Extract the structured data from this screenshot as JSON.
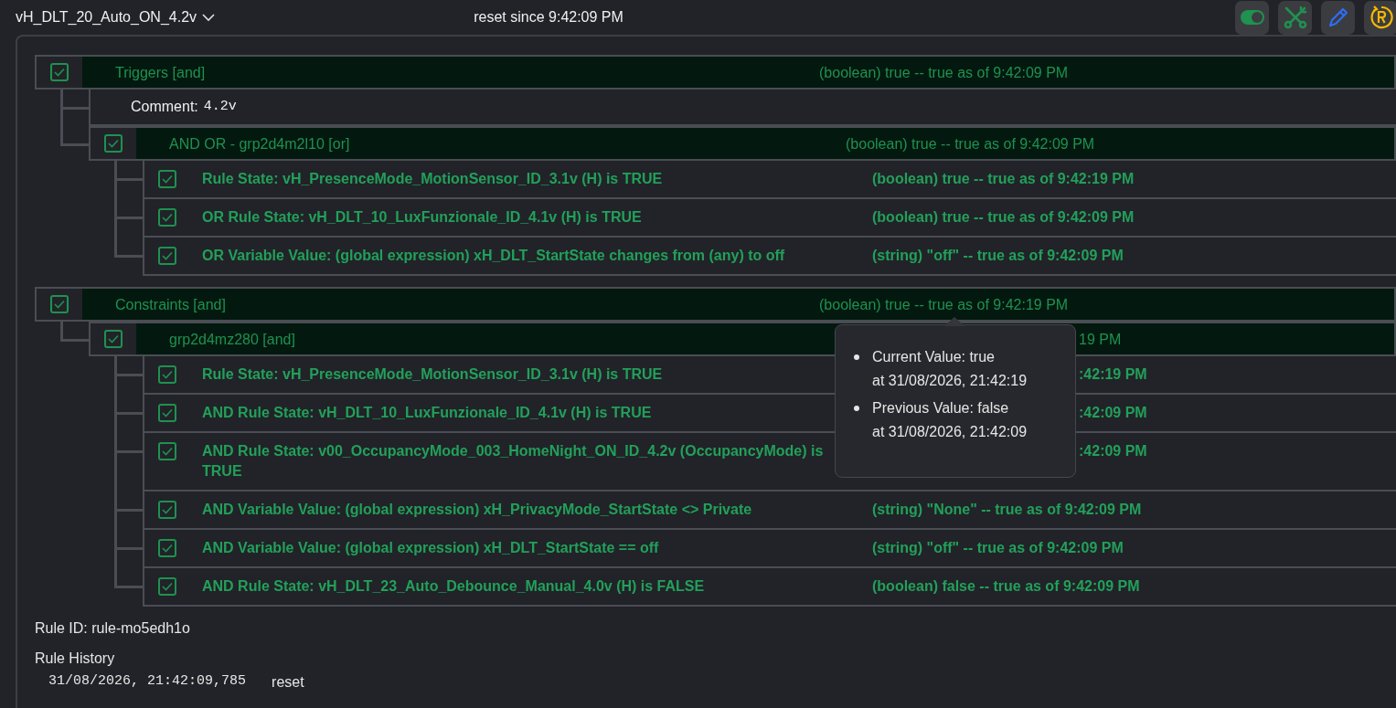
{
  "header": {
    "title": "vH_DLT_20_Auto_ON_4.2v",
    "status": "reset since 9:42:09 PM",
    "toolbar": [
      {
        "kind": "toggle",
        "on": true
      },
      {
        "kind": "tools"
      },
      {
        "kind": "edit"
      },
      {
        "kind": "reset"
      }
    ]
  },
  "tree": [
    {
      "kind": "group",
      "checked": true,
      "label": "Triggers [and]",
      "value": "(boolean) true -- true as of 9:42:09 PM",
      "children": [
        {
          "kind": "comment",
          "label": "Comment:",
          "code": "4.2v"
        },
        {
          "kind": "group",
          "checked": true,
          "label": "AND OR - grp2d4m2l10 [or]",
          "value": "(boolean) true -- true as of 9:42:09 PM",
          "children": [
            {
              "kind": "rule",
              "checked": true,
              "label": "Rule State: vH_PresenceMode_MotionSensor_ID_3.1v (H) is TRUE",
              "value": "(boolean) true -- true as of 9:42:19 PM"
            },
            {
              "kind": "rule",
              "checked": true,
              "label": "OR Rule State: vH_DLT_10_LuxFunzionale_ID_4.1v (H) is TRUE",
              "value": "(boolean) true -- true as of 9:42:09 PM"
            },
            {
              "kind": "rule",
              "checked": true,
              "label": "OR Variable Value: (global expression) xH_DLT_StartState changes from (any) to off",
              "value": "(string) \"off\" -- true as of 9:42:09 PM"
            }
          ]
        }
      ]
    },
    {
      "kind": "group",
      "checked": true,
      "label": "Constraints [and]",
      "value": "(boolean) true -- true as of 9:42:19 PM",
      "children": [
        {
          "kind": "group",
          "checked": true,
          "label": "grp2d4mz280 [and]",
          "value": "19 PM",
          "partly_hidden": true,
          "children": [
            {
              "kind": "rule",
              "checked": true,
              "label": "Rule State: vH_PresenceMode_MotionSensor_ID_3.1v (H) is TRUE",
              "value": ":42:19 PM",
              "partly_hidden": true
            },
            {
              "kind": "rule",
              "checked": true,
              "label": "AND Rule State: vH_DLT_10_LuxFunzionale_ID_4.1v (H) is TRUE",
              "value": ":42:09 PM",
              "partly_hidden": true
            },
            {
              "kind": "rule",
              "checked": true,
              "label": "AND Rule State: v00_OccupancyMode_003_HomeNight_ON_ID_4.2v (OccupancyMode) is TRUE",
              "value": ":42:09 PM",
              "partly_hidden": true
            },
            {
              "kind": "rule",
              "checked": true,
              "label": "AND Variable Value: (global expression) xH_PrivacyMode_StartState <> Private",
              "value": "(string) \"None\" -- true as of 9:42:09 PM"
            },
            {
              "kind": "rule",
              "checked": true,
              "label": "AND Variable Value: (global expression) xH_DLT_StartState == off",
              "value": "(string) \"off\" -- true as of 9:42:09 PM"
            },
            {
              "kind": "rule",
              "checked": true,
              "label": "AND Rule State: vH_DLT_23_Auto_Debounce_Manual_4.0v (H) is FALSE",
              "value": "(boolean) false -- true as of 9:42:09 PM"
            }
          ]
        }
      ]
    }
  ],
  "tooltip": {
    "items": [
      {
        "line_1": "Current Value: true",
        "line_2": "at 31/08/2026, 21:42:19"
      },
      {
        "line_1": "Previous Value: false",
        "line_2": "at 31/08/2026, 21:42:09"
      }
    ]
  },
  "rule_id": "Rule ID: rule-mo5edh1o",
  "history": {
    "title": "Rule History",
    "entries": [
      {
        "time": "31/08/2026, 21:42:09,785",
        "event": "reset"
      }
    ]
  }
}
